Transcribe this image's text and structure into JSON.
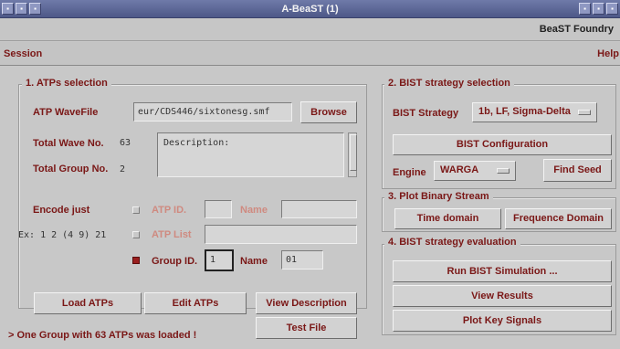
{
  "window": {
    "title": "A-BeaST (1)",
    "brand": "BeaST Foundry",
    "title_button_glyphs": [
      "▪",
      "▪",
      "▪",
      "▪",
      "▪",
      "▪"
    ]
  },
  "menubar": {
    "left": "Session",
    "right": "Help"
  },
  "atp": {
    "group_title": "1. ATPs selection",
    "wavefile_label": "ATP WaveFile",
    "wavefile_value": "eur/CDS446/sixtonesg.smf",
    "browse": "Browse",
    "total_wave_label": "Total Wave No.",
    "total_wave_value": "63",
    "total_group_label": "Total Group No.",
    "total_group_value": "2",
    "description_placeholder": "Description:",
    "encode_just": "Encode just",
    "atp_id": "ATP ID.",
    "name": "Name",
    "example": "Ex: 1 2 (4 9) 21",
    "atp_list": "ATP List",
    "group_id": "Group ID.",
    "group_id_value": "1",
    "group_name_value": "01",
    "load_atps": "Load ATPs",
    "edit_atps": "Edit ATPs",
    "view_description": "View Description",
    "test_file": "Test File",
    "status": "> One Group with 63 ATPs was loaded !"
  },
  "bist": {
    "group_title": "2. BIST strategy selection",
    "strategy_label": "BIST Strategy",
    "strategy_value": "1b, LF, Sigma-Delta",
    "configuration": "BIST Configuration",
    "engine_label": "Engine",
    "engine_value": "WARGA",
    "find_seed": "Find Seed"
  },
  "plot": {
    "group_title": "3. Plot Binary Stream",
    "time_domain": "Time domain",
    "frequence_domain": "Frequence Domain"
  },
  "eval": {
    "group_title": "4. BIST strategy evaluation",
    "run_simulation": "Run BIST Simulation ...",
    "view_results": "View Results",
    "plot_key_signals": "Plot Key Signals"
  },
  "colors": {
    "accent_text": "#7a1716",
    "disabled_text": "#cf8a80",
    "titlebar": "#5b669a",
    "window_bg": "#c8c8c8"
  }
}
